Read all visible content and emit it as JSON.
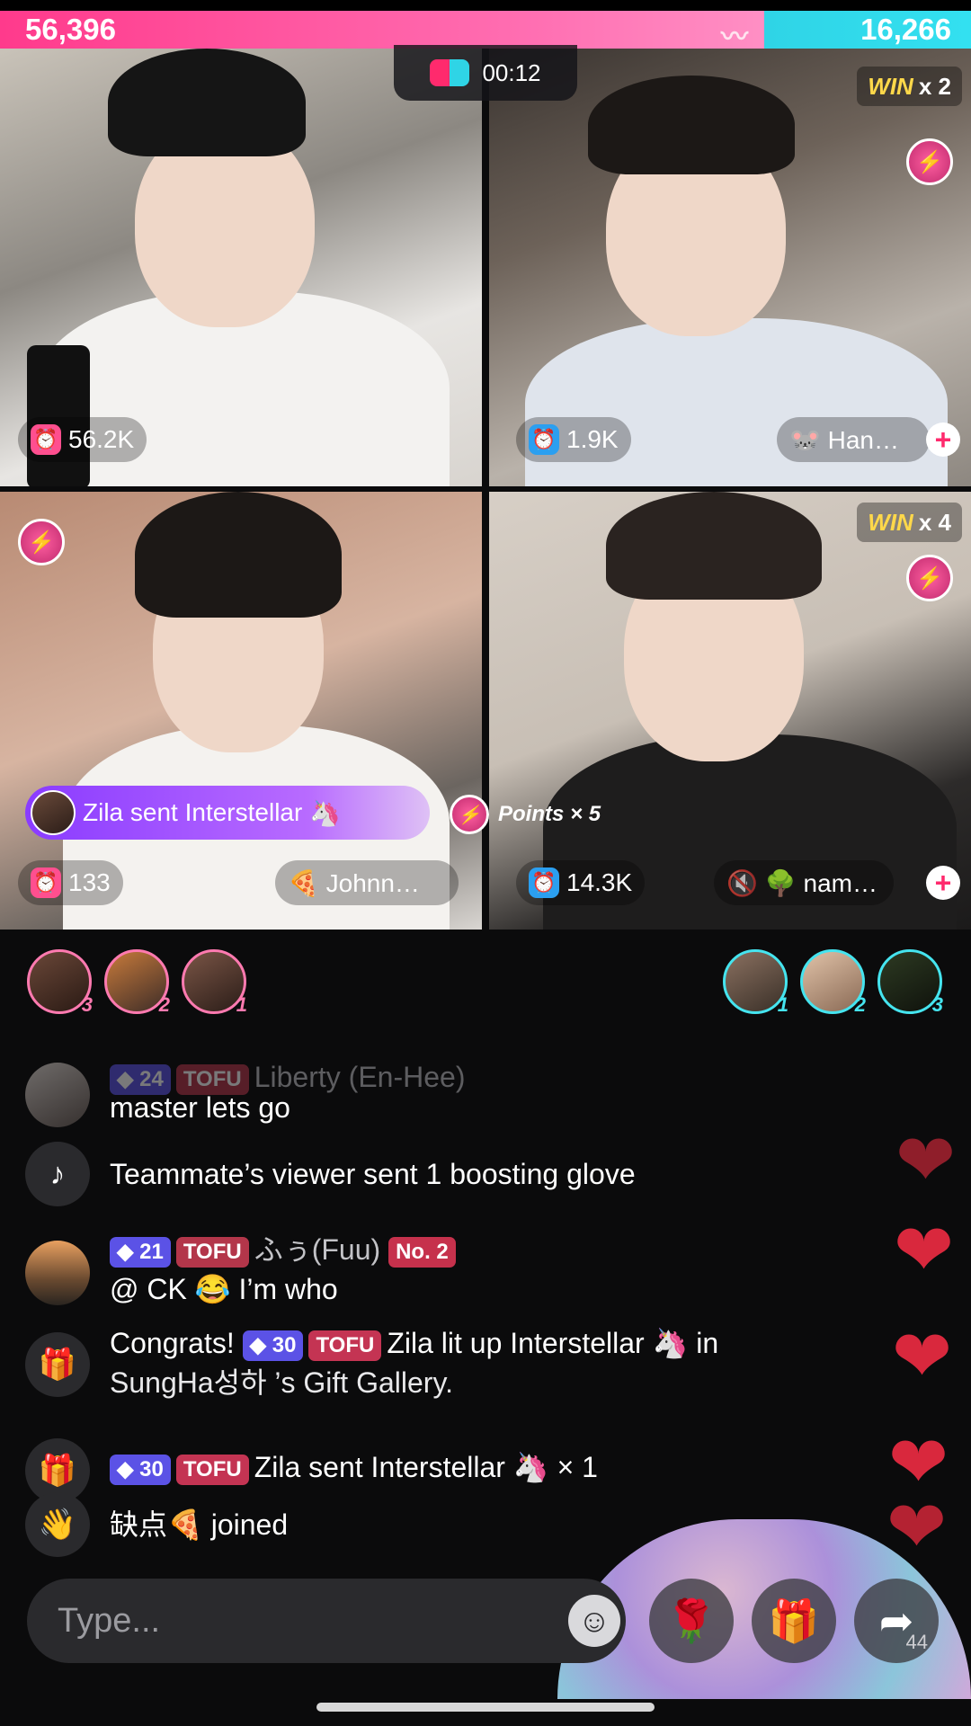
{
  "score": {
    "left": "56,396",
    "right": "16,266"
  },
  "timer": "00:12",
  "tiles": [
    {
      "gift_count": "56.2K"
    },
    {
      "gift_count": "1.9K",
      "win_label": "WIN",
      "win_mult": "x 2",
      "guest": "🐭 Han…"
    },
    {
      "gift_count": "133",
      "guest": "🍕 Johnn…"
    },
    {
      "gift_count": "14.3K",
      "win_label": "WIN",
      "win_mult": "x 4",
      "guest": "🌳 nam…"
    }
  ],
  "gift_banner": {
    "text": "Zila sent Interstellar"
  },
  "points": "Points × 5",
  "rank_left": [
    "3",
    "2",
    "1"
  ],
  "rank_right": [
    "1",
    "2",
    "3"
  ],
  "chat": [
    {
      "level": "24",
      "tofu": "TOFU",
      "name": "Liberty (En-Hee)",
      "text": "master lets go"
    },
    {
      "text": "Teammate’s viewer sent 1 boosting glove"
    },
    {
      "level": "21",
      "tofu": "TOFU",
      "name": "ふぅ(Fuu)",
      "rank": "No. 2",
      "text": "@ CK 😂 I’m who"
    },
    {
      "prefix": "Congrats!",
      "level": "30",
      "tofu": "TOFU",
      "line1": "Zila lit up Interstellar 🦄 in",
      "line2": "SungHa성하 ’s Gift Gallery."
    },
    {
      "level": "30",
      "tofu": "TOFU",
      "text": "Zila sent Interstellar 🦄 × 1"
    },
    {
      "text": "缺点🍕 joined"
    }
  ],
  "input": {
    "placeholder": "Type..."
  },
  "share_count": "44",
  "icons": {
    "rose": "🌹",
    "gift": "🎁",
    "share": "➦"
  }
}
